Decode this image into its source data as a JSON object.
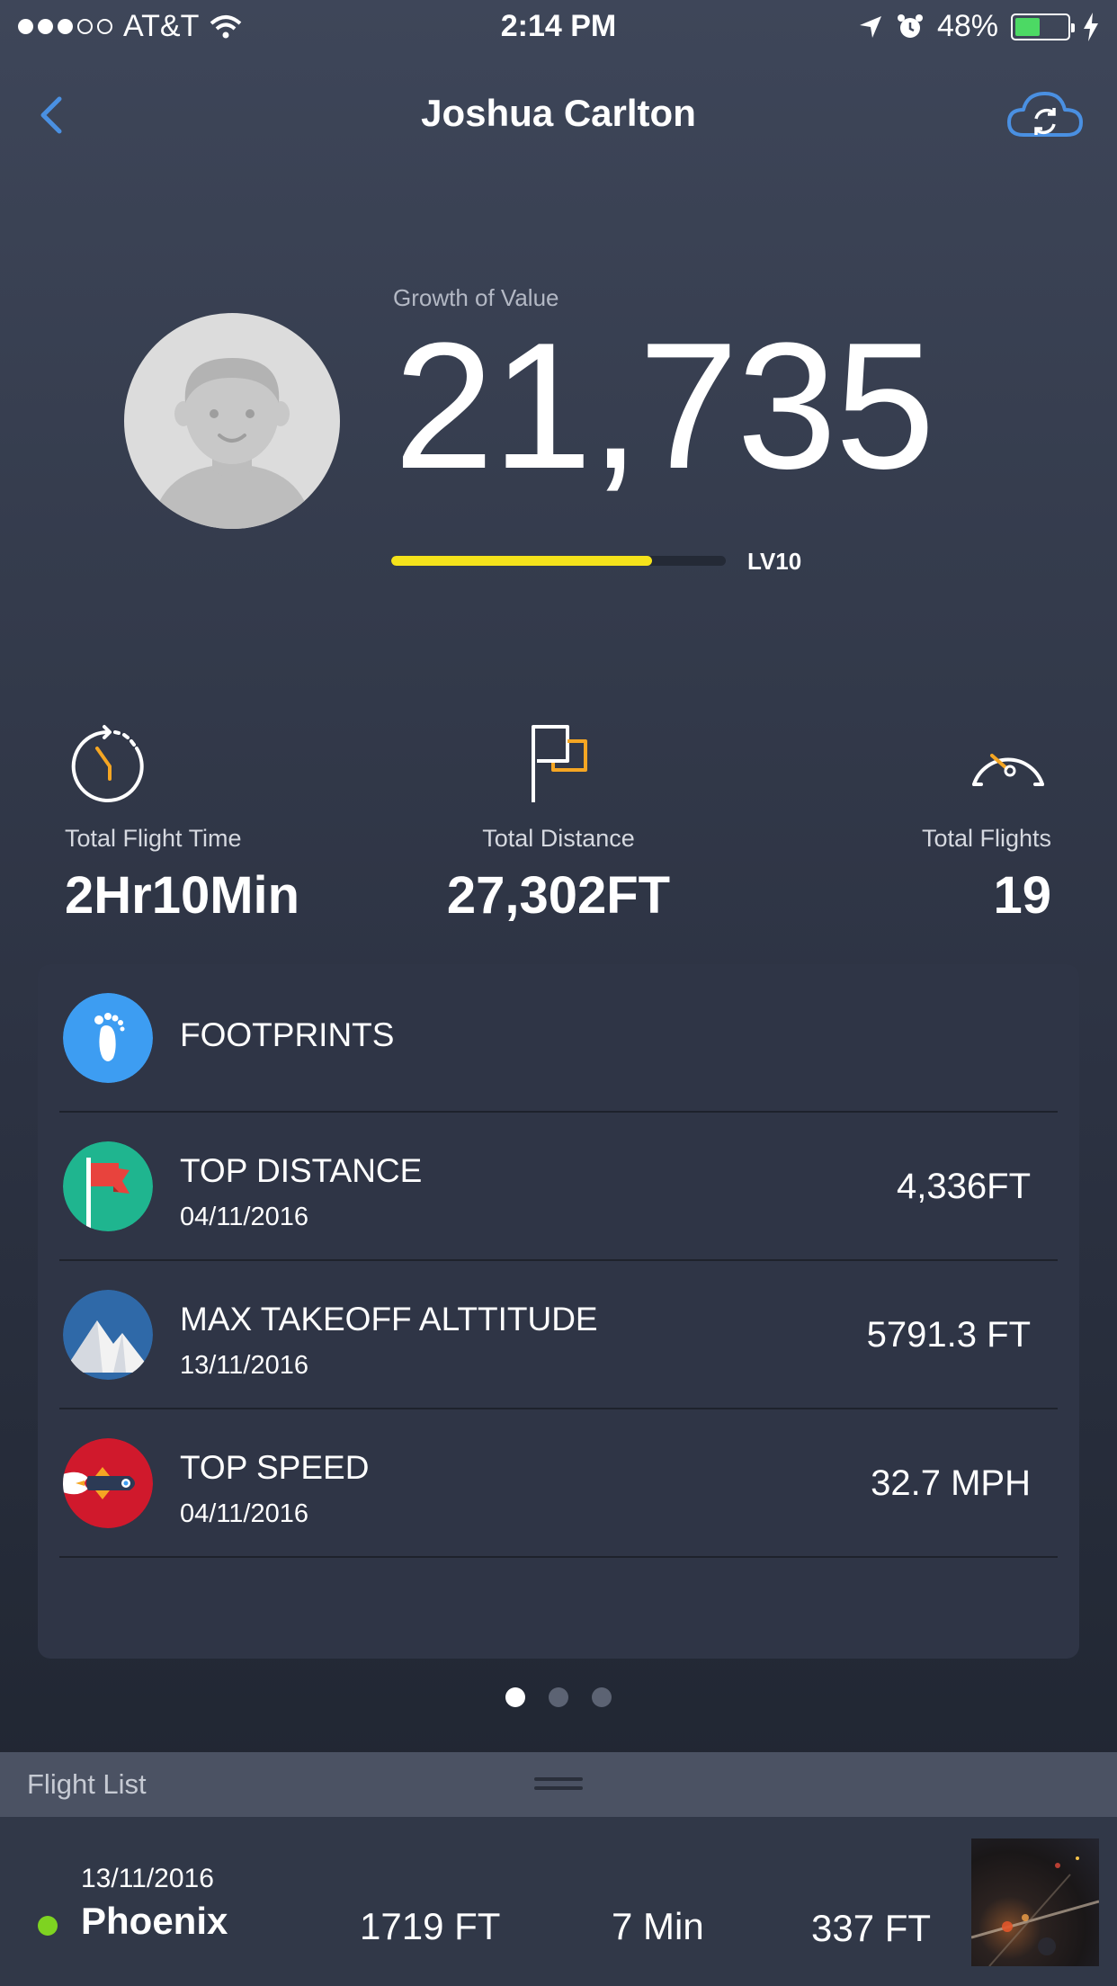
{
  "status_bar": {
    "carrier": "AT&T",
    "time": "2:14 PM",
    "battery_percent": "48%",
    "battery_level": 0.48,
    "signal_bars_filled": 3,
    "signal_bars_total": 5
  },
  "nav": {
    "title": "Joshua Carlton",
    "back_icon": "chevron-left-icon",
    "sync_icon": "cloud-sync-icon",
    "accent_color": "#4a90e2"
  },
  "profile": {
    "growth_label": "Growth of Value",
    "growth_value": "21,735",
    "level_label": "LV10",
    "level_progress": 0.78,
    "level_bar_color": "#f5e31b"
  },
  "stats": [
    {
      "icon": "stopwatch-icon",
      "label": "Total Flight Time",
      "value": "2Hr10Min"
    },
    {
      "icon": "flag-icon",
      "label": "Total Distance",
      "value": "27,302FT"
    },
    {
      "icon": "speedometer-icon",
      "label": "Total Flights",
      "value": "19"
    }
  ],
  "records": [
    {
      "icon": "footprints-icon",
      "title": "FOOTPRINTS",
      "date": "",
      "value": ""
    },
    {
      "icon": "red-flag-icon",
      "title": "TOP DISTANCE",
      "date": "04/11/2016",
      "value": "4,336FT"
    },
    {
      "icon": "mountain-icon",
      "title": "MAX TAKEOFF ALTTITUDE",
      "date": "13/11/2016",
      "value": "5791.3 FT"
    },
    {
      "icon": "rocket-icon",
      "title": "TOP SPEED",
      "date": "04/11/2016",
      "value": "32.7 MPH"
    }
  ],
  "pager": {
    "pages": 3,
    "active": 0
  },
  "flight_list": {
    "title": "Flight List",
    "items": [
      {
        "date": "13/11/2016",
        "city": "Phoenix",
        "altitude": "1719 FT",
        "duration": "7 Min",
        "distance": "337 FT",
        "status_color": "#7ed321"
      }
    ]
  }
}
